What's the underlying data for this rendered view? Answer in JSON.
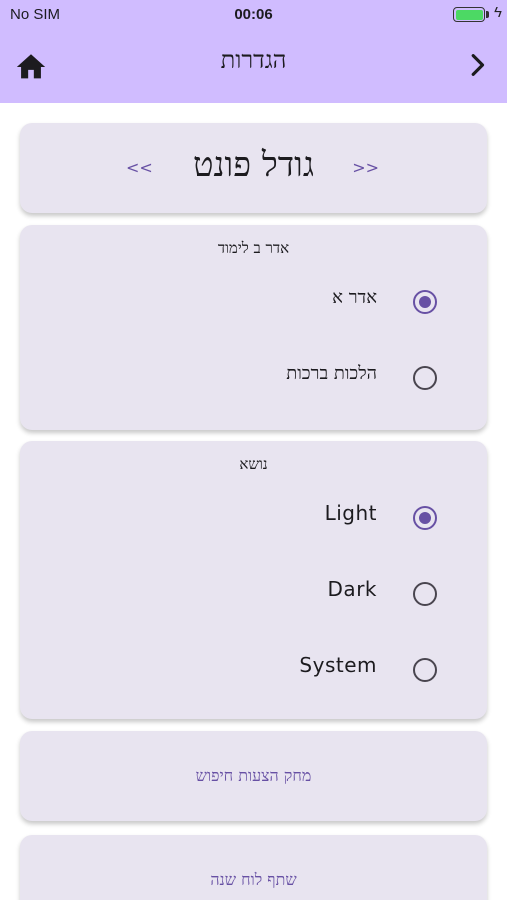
{
  "status_bar": {
    "carrier": "No SIM",
    "time": "00:06",
    "battery_level": 1.0
  },
  "app_bar": {
    "title": "הגדרות",
    "home_icon": "home-icon",
    "back_icon": "chevron-right-icon",
    "color": "#d0bcff"
  },
  "font_size": {
    "title": "גודל פונט",
    "decrease_label": "<<",
    "increase_label": ">>"
  },
  "study": {
    "title": "אדר ב לימוד",
    "options": [
      {
        "label": "אדר א",
        "selected": true
      },
      {
        "label": "הלכות ברכות",
        "selected": false
      }
    ]
  },
  "theme": {
    "title": "נושא",
    "options": [
      {
        "label": "Light",
        "selected": true
      },
      {
        "label": "Dark",
        "selected": false
      },
      {
        "label": "System",
        "selected": false
      }
    ]
  },
  "actions": {
    "clear_search_suggestions": "מחק הצעות חיפוש",
    "share_calendar": "שתף לוח שנה"
  },
  "colors": {
    "accent": "#6750a4",
    "card": "#e8e4f0"
  }
}
